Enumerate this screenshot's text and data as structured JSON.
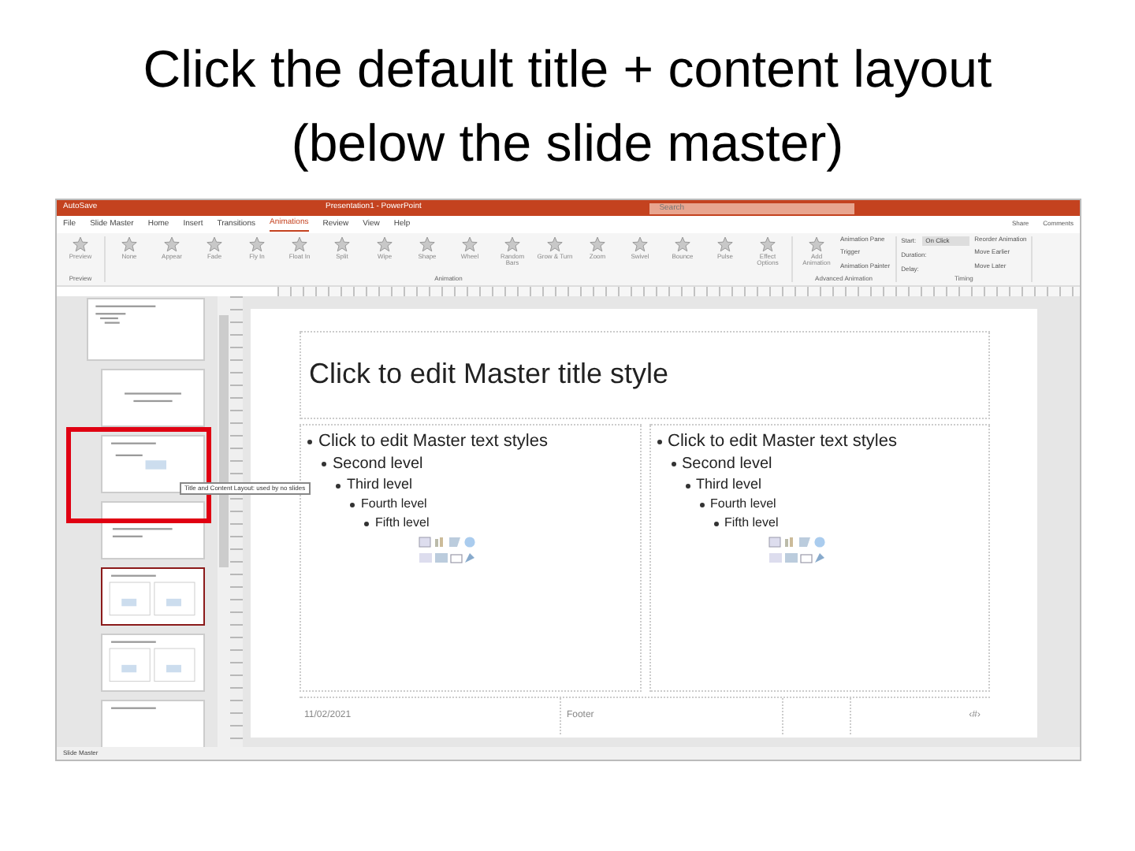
{
  "heading": "Click the default title + content layout (below the slide master)",
  "title_bar": {
    "quick_access": "AutoSave",
    "title": "Presentation1 - PowerPoint",
    "search_placeholder": "Search"
  },
  "tabs": [
    {
      "label": "File",
      "selected": false
    },
    {
      "label": "Slide Master",
      "selected": false
    },
    {
      "label": "Home",
      "selected": false
    },
    {
      "label": "Insert",
      "selected": false
    },
    {
      "label": "Transitions",
      "selected": false
    },
    {
      "label": "Animations",
      "selected": true
    },
    {
      "label": "Review",
      "selected": false
    },
    {
      "label": "View",
      "selected": false
    },
    {
      "label": "Help",
      "selected": false
    }
  ],
  "share": {
    "share": "Share",
    "comments": "Comments"
  },
  "ribbon": {
    "preview": "Preview",
    "preview_group": "Preview",
    "effects": [
      "None",
      "Appear",
      "Fade",
      "Fly In",
      "Float In",
      "Split",
      "Wipe",
      "Shape",
      "Wheel",
      "Random Bars",
      "Grow & Turn",
      "Zoom",
      "Swivel",
      "Bounce",
      "Pulse"
    ],
    "animation_group": "Animation",
    "effect_options": "Effect Options",
    "add_animation": "Add Animation",
    "advanced": [
      "Animation Pane",
      "Trigger",
      "Animation Painter"
    ],
    "advanced_group": "Advanced Animation",
    "timing": [
      {
        "label": "Start:",
        "value": "On Click"
      },
      {
        "label": "Duration:"
      },
      {
        "label": "Delay:"
      }
    ],
    "reorder": "Reorder Animation",
    "reorder_items": [
      "Move Earlier",
      "Move Later"
    ],
    "timing_group": "Timing"
  },
  "thumbnails": [
    {
      "kind": "master",
      "selected": false
    },
    {
      "kind": "title",
      "selected": false
    },
    {
      "kind": "content",
      "selected": false
    },
    {
      "kind": "section",
      "selected": false
    },
    {
      "kind": "two",
      "selected": true
    },
    {
      "kind": "two",
      "selected": false
    },
    {
      "kind": "titleonly",
      "selected": false
    }
  ],
  "tooltip": "Title and Content Layout: used by no slides",
  "slide": {
    "title": "Click to edit Master title style",
    "columns": [
      {
        "items": [
          {
            "text": "Click to edit Master text styles",
            "children": [
              {
                "text": "Second level",
                "children": [
                  {
                    "text": "Third level",
                    "children": [
                      {
                        "text": "Fourth level",
                        "children": [
                          {
                            "text": "Fifth level"
                          }
                        ]
                      }
                    ]
                  }
                ]
              }
            ]
          }
        ]
      },
      {
        "items": [
          {
            "text": "Click to edit Master text styles",
            "children": [
              {
                "text": "Second level",
                "children": [
                  {
                    "text": "Third level",
                    "children": [
                      {
                        "text": "Fourth level",
                        "children": [
                          {
                            "text": "Fifth level"
                          }
                        ]
                      }
                    ]
                  }
                ]
              }
            ]
          }
        ]
      }
    ],
    "footer": {
      "date": "11/02/2021",
      "text": "Footer",
      "number": "‹#›"
    }
  },
  "status_bar": {
    "view": "Slide Master"
  }
}
